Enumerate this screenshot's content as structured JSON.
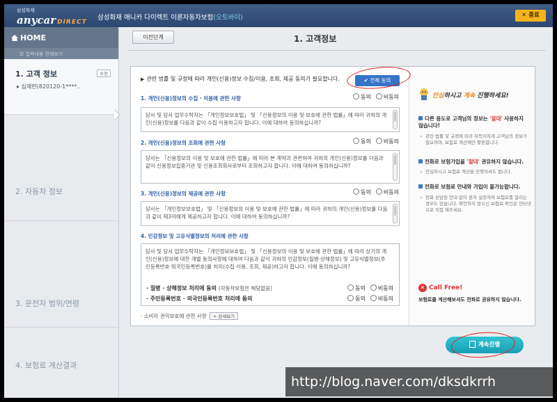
{
  "header": {
    "brand_small": "삼성화재",
    "brand_main": "anycar",
    "brand_sub": "DIRECT",
    "product_title": "삼성화재 애니카 다이렉트 이륜자동차보험",
    "product_accent": "(오토바이)",
    "exit_label": "✕ 종료"
  },
  "sidebar": {
    "home_label": "HOME",
    "review_link": "☰ 입력내용 전체보기",
    "steps": [
      {
        "label": "1. 고객 정보",
        "badge": "수정",
        "sub": "▸ 심재련(820120-1****..",
        "active": true
      },
      {
        "label": "2. 자동차 정보"
      },
      {
        "label": "3. 운전자 범위/연령"
      },
      {
        "label": "4. 보험료 계산결과"
      }
    ]
  },
  "main": {
    "prev_button": "이전단계",
    "page_title": "1. 고객정보",
    "intro": "관련 법률 및 규정에 따라 개인(신용)정보 수집/이용, 조회, 제공 동의가 필요합니다.",
    "agree_all": "✔ 전체 동의",
    "agree_label": "동의",
    "disagree_label": "비동의",
    "sections": [
      {
        "title": "1. 개인(신용)정보의 수집 · 이용에 관한 사항",
        "text": "당사 및 당사 업무수탁자는 「개인정보보호법」 및 「신용정보의 이용 및 보호에 관한 법률」에 따라 귀하의 개인(신용)정보를 다음과 같이 수집·이용하고자 합니다.  이에 대하여 동의하십니까?"
      },
      {
        "title": "2. 개인(신용)정보의 조회에 관한 사항",
        "text": "당사는 「신용정보의 이용 및 보호에 관한 법률」에 따라 본 계약과 관련하여 귀하의 개인(신용)정보를 다음과 같이 신용정보집중기관 및 신용조회회사로부터 조회하고자 합니다. 이에 대하여 동의하십니까?"
      },
      {
        "title": "3. 개인(신용)정보의 제공에 관한 사항",
        "text": "당사는 「개인정보보호법」 및 「신용정보의 이용 및 보호에 관한 법률」에 따라 귀하의 개인(신용)정보를 다음과 같이 제3자에게 제공하고자 합니다. 이에 대하여 동의하십니까?"
      },
      {
        "title": "4. 민감정보 및 고유식별정보의 처리에 관한 사항",
        "text": "당사 및 당사 업무수탁자는 「개인정보보호법」 및 「신용정보의 이용 및 보호에 관한 법률」에 따라 상기의 개인(신용)정보에 대한 개별 동의사항에 대하여 다음과 같이 귀하의 민감정보(질병·상해정보) 및 고유식별정보(주민등록번호·외국인등록번호)를 처리(수집·이용, 조회, 제공)하고자 합니다. 이에 동의하십니까?"
      }
    ],
    "sub_items": [
      {
        "label": "· 질병 · 상해정보 처리에 동의",
        "note": "(자동차보험은 해당없음)"
      },
      {
        "label": "· 주민등록번호 · 외국인등록번호 처리에 동의",
        "note": ""
      }
    ],
    "consumer_rights": "· 소비자 권익보호에 관한 사항",
    "detail_button": "+ 상세보기",
    "continue_button": "계속진행"
  },
  "tips": {
    "head_a": "안심",
    "head_b": "하시고 ",
    "head_c": "계속",
    "head_d": " 진행하세요!",
    "items": [
      {
        "h1": "다른 용도로 고객님의 정보는 ",
        "h_red": "'절대'",
        "h2": " 사용하지 않습니다!",
        "body": "관련 법률 및 규정에 따라 부득이하게 고객님의 정보가 필요하며, 보험료 계산에만 활용합니다."
      },
      {
        "h1": "전화로 보험가입을 ",
        "h_red": "'절대'",
        "h2": " 권유하지 않습니다.",
        "body": "안심하시고 보험료 계산을 진행하셔도 됩니다."
      },
      {
        "h1": "전화로 보험료 안내와 가입이 불가능합니다.",
        "h_red": "",
        "h2": "",
        "body": "전화 상담원 안내 없이 혼자 설정하여 보험료를 알리는 경우도 있습니다. 확인하지 않으신 보험료 확인은 인터넷으로 직접 해주세요."
      }
    ],
    "callfree": "Call Free!",
    "callfree_note": "보험료를 계산해보셔도 전화로 권유하지 않습니다."
  },
  "watermark": "http://blog.naver.com/dksdkrrh",
  "colors": {
    "header": "#2c4770",
    "accent_blue": "#3573c9",
    "section_title": "#2d5fa5",
    "continue": "#1a9fb5",
    "exit": "#f5b41e",
    "annotation_red": "#e21d1d"
  }
}
